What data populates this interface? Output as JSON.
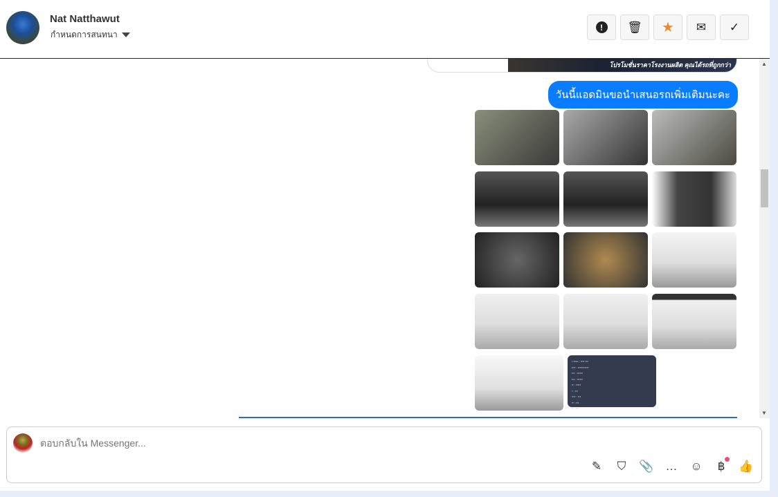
{
  "header": {
    "name": "Nat Natthawut",
    "subtitle": "กำหนดการสนทนา",
    "buttons": [
      {
        "name": "report",
        "icon": "!"
      },
      {
        "name": "delete",
        "icon": "🗑"
      },
      {
        "name": "star",
        "icon": "★"
      },
      {
        "name": "mark-unread",
        "icon": "✉"
      },
      {
        "name": "done",
        "icon": "✓"
      }
    ]
  },
  "chat": {
    "banner_text": "โปรโมชั่นราคาโรงงานผลิต คุณได้รถที่ถูกกว่า",
    "message": "วันนี้แอดมินขอนำเสนอรถเพิ่มเติมนะคะ",
    "photos": 14
  },
  "composer": {
    "placeholder": "ตอบกลับใน Messenger...",
    "tools": [
      {
        "name": "saved-reply",
        "icon": "✎"
      },
      {
        "name": "shop",
        "icon": "⛉"
      },
      {
        "name": "attach",
        "icon": "📎"
      },
      {
        "name": "chat",
        "icon": "…"
      },
      {
        "name": "emoji",
        "icon": "☺"
      },
      {
        "name": "payment",
        "icon": "฿"
      },
      {
        "name": "like",
        "icon": "👍"
      }
    ]
  },
  "colors": {
    "accent": "#0a7cff"
  }
}
